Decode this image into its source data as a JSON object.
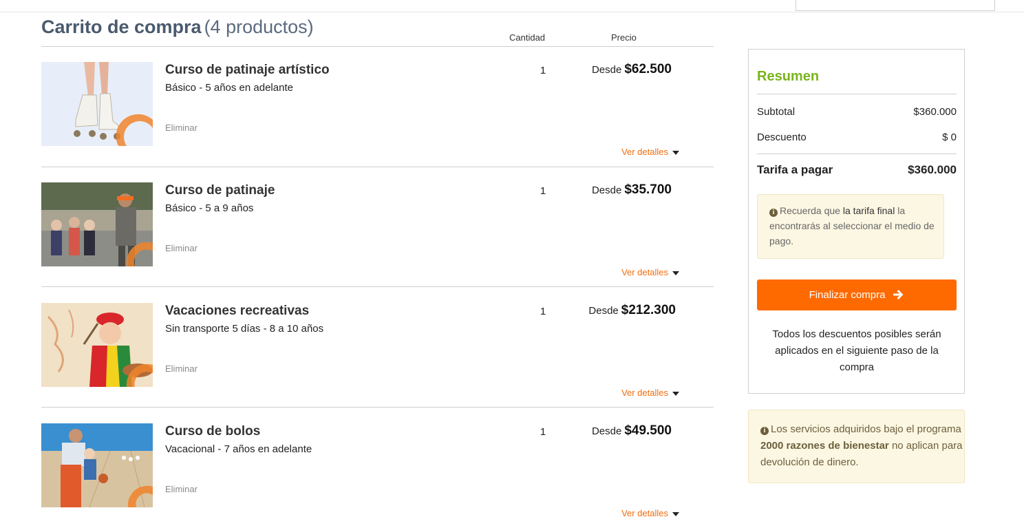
{
  "cart": {
    "title": "Carrito de compra",
    "count_label": "(4 productos)",
    "col_quantity": "Cantidad",
    "col_price": "Precio",
    "items": [
      {
        "name": "Curso de patinaje artístico",
        "sub": "Básico - 5 años en adelante",
        "qty": "1",
        "price_prefix": "Desde",
        "price": "$62.500",
        "remove": "Eliminar",
        "details": "Ver detalles"
      },
      {
        "name": "Curso de patinaje",
        "sub": "Básico - 5 a 9 años",
        "qty": "1",
        "price_prefix": "Desde",
        "price": "$35.700",
        "remove": "Eliminar",
        "details": "Ver detalles"
      },
      {
        "name": "Vacaciones recreativas",
        "sub": "Sin transporte 5 días - 8 a 10 años",
        "qty": "1",
        "price_prefix": "Desde",
        "price": "$212.300",
        "remove": "Eliminar",
        "details": "Ver detalles"
      },
      {
        "name": "Curso de bolos",
        "sub": "Vacacional - 7 años en adelante",
        "qty": "1",
        "price_prefix": "Desde",
        "price": "$49.500",
        "remove": "Eliminar",
        "details": "Ver detalles"
      }
    ]
  },
  "summary": {
    "title": "Resumen",
    "subtotal_label": "Subtotal",
    "subtotal_value": "$360.000",
    "discount_label": "Descuento",
    "discount_value": "$ 0",
    "total_label": "Tarifa a pagar",
    "total_value": "$360.000",
    "note_prefix": "Recuerda que",
    "note_highlight": "la tarifa final",
    "note_suffix": "la encontrarás al seleccionar el medio de pago.",
    "checkout_label": "Finalizar compra",
    "footer_text": "Todos los descuentos posibles serán aplicados en el siguiente paso de la compra"
  },
  "notice": {
    "prefix": "Los servicios adquiridos bajo el programa",
    "highlight": "2000 razones de bienestar",
    "suffix": "no aplican para devolución de dinero."
  },
  "colors": {
    "accent": "#ff6a00",
    "link": "#f26c0d",
    "summary_title": "#7ab41d",
    "note_bg": "#fcf7e3"
  },
  "icons": {
    "info": "info-circle-icon",
    "arrow": "arrow-right-icon",
    "caret": "caret-down-icon"
  }
}
